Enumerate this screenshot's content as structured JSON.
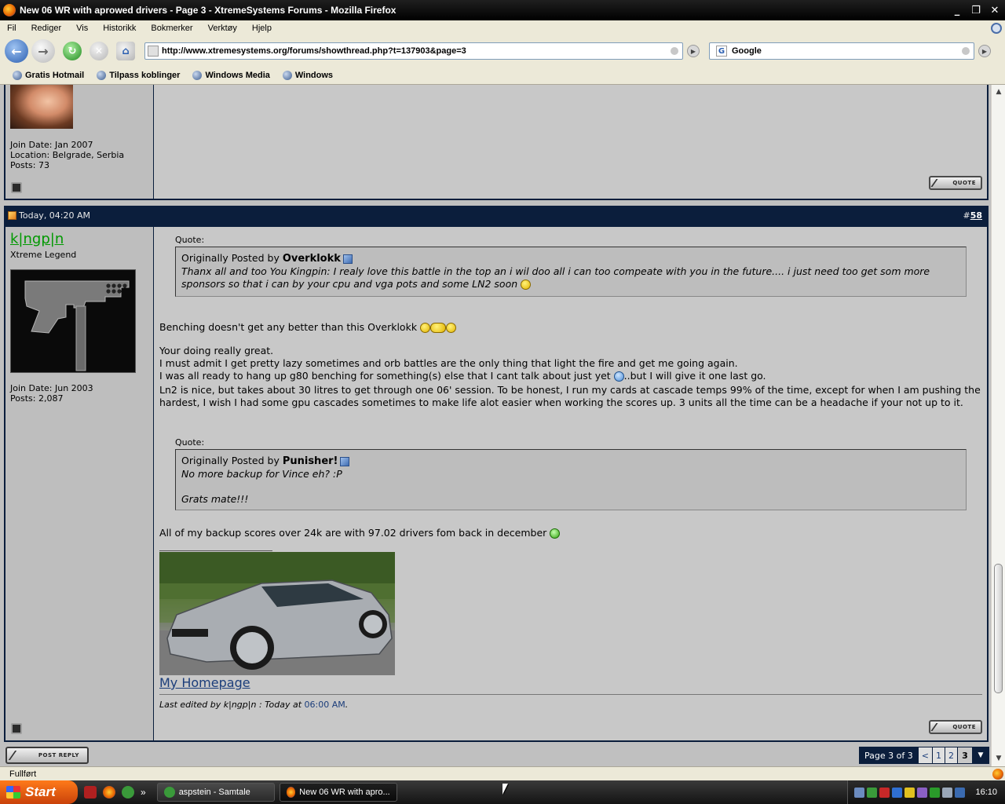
{
  "window": {
    "title": "New 06 WR with aprowed drivers - Page 3 - XtremeSystems Forums - Mozilla Firefox",
    "controls": [
      "_",
      "❐",
      "✕"
    ]
  },
  "menu": [
    "Fil",
    "Rediger",
    "Vis",
    "Historikk",
    "Bokmerker",
    "Verktøy",
    "Hjelp"
  ],
  "nav": {
    "url": "http://www.xtremesystems.org/forums/showthread.php?t=137903&page=3",
    "search_engine": "Google"
  },
  "bookmarks": [
    "Gratis Hotmail",
    "Tilpass koblinger",
    "Windows Media",
    "Windows"
  ],
  "prev_post": {
    "join_date": "Join Date: Jan 2007",
    "location": "Location: Belgrade, Serbia",
    "posts": "Posts: 73",
    "quote_label": "QUOTE"
  },
  "post": {
    "date": "Today, 04:20 AM",
    "number_prefix": "#",
    "number": "58",
    "username": "k|ngp|n",
    "user_title": "Xtreme Legend",
    "join_date": "Join Date: Jun 2003",
    "posts": "Posts: 2,087",
    "quote1": {
      "label": "Quote:",
      "originally": "Originally Posted by",
      "author": "Overklokk",
      "text": "Thanx all and too You Kingpin: I realy love this battle in the top an i wil doo all i can too compeate with you in the future.... i just need too get som more sponsors so that i can by your cpu and vga pots and some LN2 soon"
    },
    "para1": "Benching doesn't get any better than this Overklokk",
    "para2_l1": "Your doing really great.",
    "para2_l2": "I must admit I get pretty lazy sometimes and orb battles are the only thing that light the fire and get me going again.",
    "para2_l3a": "I was all ready to hang up g80 benching for something(s) else that I cant talk about just yet",
    "para2_l3b": "..but I will give it one last go.",
    "para3": "Ln2 is nice, but takes about 30 litres to get through one 06' session. To be honest, I run my cards at cascade temps 99% of the time, except for when I am pushing the hardest, I wish I had some gpu cascades sometimes to make life alot easier when working the scores up. 3 units all the time can be a headache if your not up to it.",
    "quote2": {
      "label": "Quote:",
      "originally": "Originally Posted by",
      "author": "Punisher!",
      "line1": "No more backup for Vince eh? :P",
      "line2": "Grats mate!!!"
    },
    "para4": "All of my backup scores over 24k are with 97.02 drivers fom back in december",
    "homepage": "My Homepage",
    "edited_prefix": "Last edited by k|ngp|n : Today at",
    "edited_time": "06:00 AM",
    "edited_suffix": ".",
    "quote_label": "QUOTE"
  },
  "footer": {
    "post_reply": "POST REPLY",
    "page_label": "Page 3 of 3",
    "prev": "<",
    "pages": [
      "1",
      "2"
    ],
    "current": "3",
    "menu_arrow": "▼"
  },
  "status": "Fullført",
  "taskbar": {
    "start": "Start",
    "quicklaunch_more": "»",
    "tasks": [
      "aspstein - Samtale",
      "New 06 WR with apro..."
    ],
    "clock": "16:10"
  },
  "colors": {
    "post_header": "#0b1e3c",
    "username": "#009900",
    "link": "#1b3d7a"
  }
}
